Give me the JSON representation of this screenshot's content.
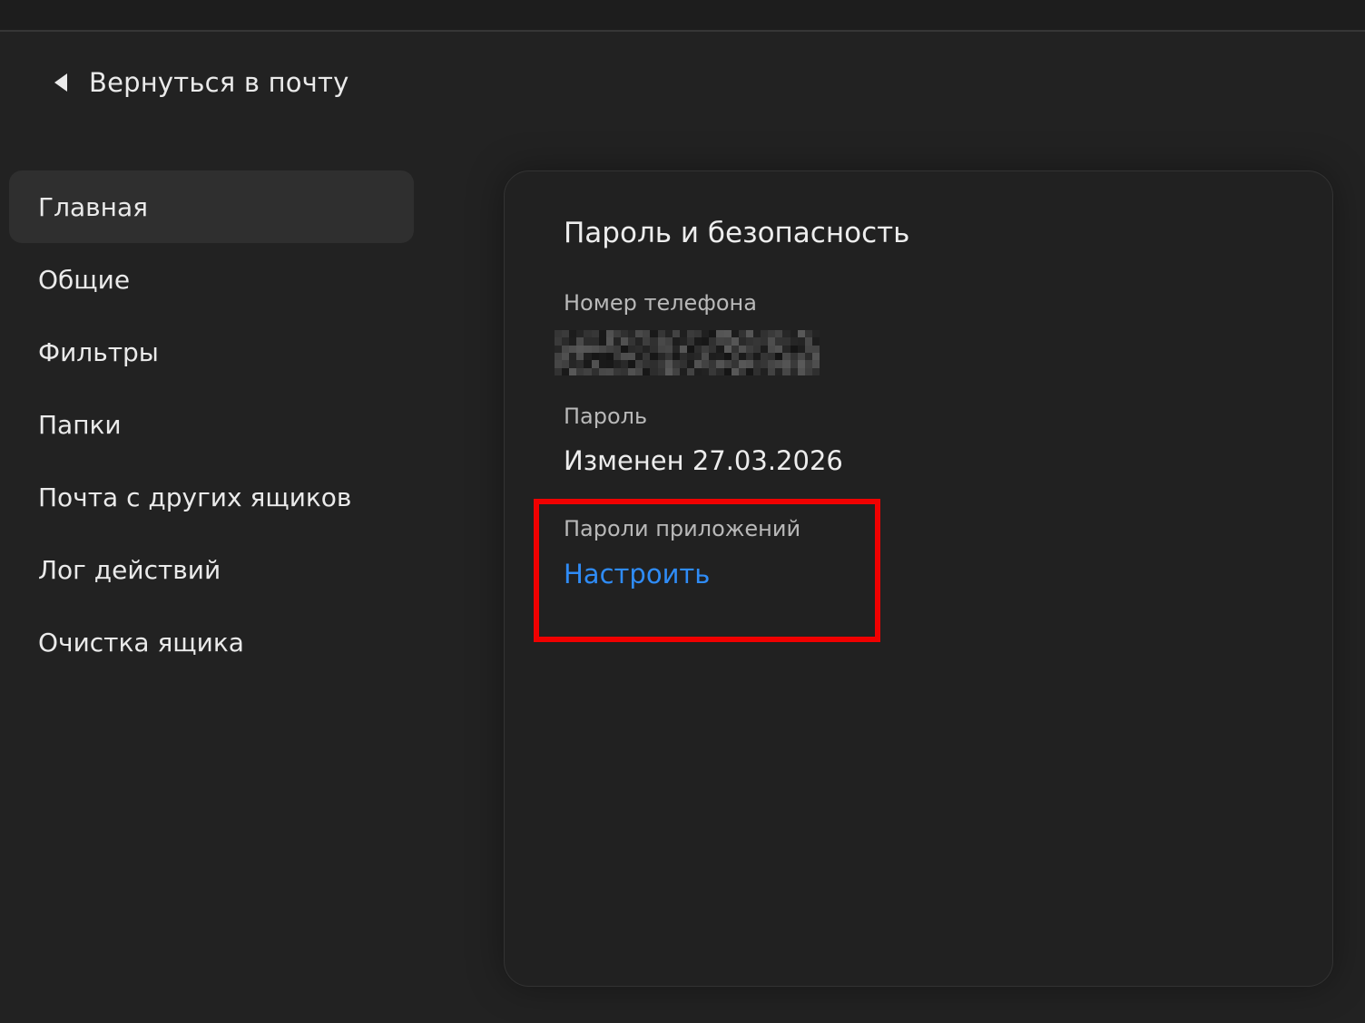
{
  "nav": {
    "back_label": "Вернуться в почту",
    "back_icon": "arrow-left-icon"
  },
  "sidebar": {
    "items": [
      {
        "label": "Главная",
        "active": true
      },
      {
        "label": "Общие",
        "active": false
      },
      {
        "label": "Фильтры",
        "active": false
      },
      {
        "label": "Папки",
        "active": false
      },
      {
        "label": "Почта с других ящиков",
        "active": false
      },
      {
        "label": "Лог действий",
        "active": false
      },
      {
        "label": "Очистка ящика",
        "active": false
      }
    ]
  },
  "security": {
    "title": "Пароль и безопасность",
    "phone_label": "Номер телефона",
    "password_label": "Пароль",
    "password_value": "Изменен 27.03.2026",
    "app_passwords_label": "Пароли приложений",
    "configure_link": "Настроить"
  },
  "colors": {
    "background": "#222222",
    "link": "#2f8cf7",
    "highlight": "#f00000",
    "active_item": "#2f2f2f"
  }
}
